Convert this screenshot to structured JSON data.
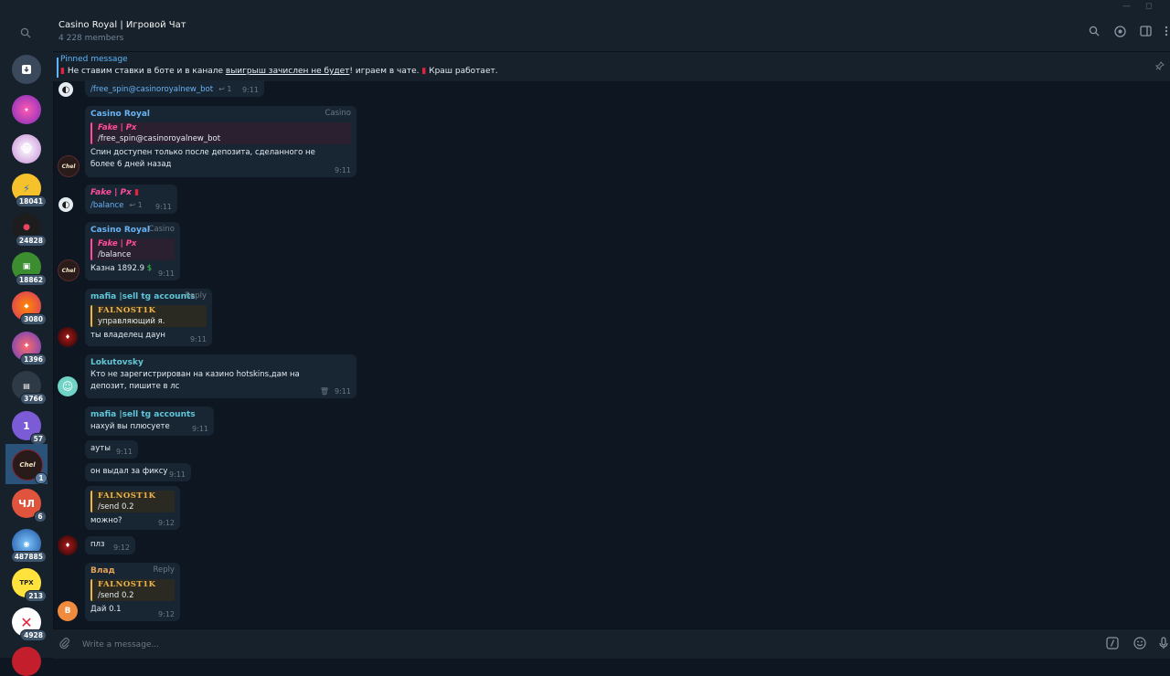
{
  "window": {
    "minimize": "—",
    "maximize": "◻"
  },
  "header": {
    "title": "Casino Royal | Игровой Чат",
    "members": "4 228 members"
  },
  "pinned": {
    "label": "Pinned message",
    "text_before": " Не ставим ставки в боте и в канале ",
    "text_underlined": "выигрыш зачислен не будет",
    "text_mid": "! играем в чате. ",
    "text_after": " Краш работает."
  },
  "rail": {
    "badges": [
      "18041",
      "24828",
      "18862",
      "3080",
      "1396",
      "3766",
      "57",
      "1",
      "6",
      "487885",
      "213",
      "4928"
    ],
    "chl_label": "ЧЛ",
    "one_label": "1"
  },
  "messages": {
    "m0": {
      "text": "/free_spin@casinoroyalnew_bot",
      "replies": "1",
      "time": "9:11"
    },
    "m1": {
      "sender": "Casino Royal",
      "tag": "Casino",
      "reply_name": "Fake | Px",
      "reply_text": "/free_spin@casinoroyalnew_bot",
      "text": "Спин доступен только после депозита, сделанного не более 6 дней назад",
      "time": "9:11"
    },
    "m2": {
      "sender": "Fake | Px",
      "text": "/balance",
      "replies": "1",
      "time": "9:11"
    },
    "m3": {
      "sender": "Casino Royal",
      "tag": "Casino",
      "reply_name": "Fake | Px",
      "reply_text": "/balance",
      "text": "Казна 1892.9",
      "time": "9:11"
    },
    "m4": {
      "sender": "mafia |sell tg accounts",
      "tag": "Reply",
      "reply_name": "FALNOST1K",
      "reply_text": "управляющий я.",
      "text": "ты владелец даун",
      "time": "9:11"
    },
    "m5": {
      "sender": "Lokutovsky",
      "text": "Кто не зарегистрирован на казино hotskins,дам на депозит, пишите в лс",
      "time": "9:11"
    },
    "m6": {
      "sender": "mafia |sell tg accounts",
      "text": "нахуй вы плюсуете",
      "time": "9:11"
    },
    "m7": {
      "text": "ауты",
      "time": "9:11"
    },
    "m8": {
      "text": "он выдал за фиксу",
      "time": "9:11"
    },
    "m9": {
      "reply_name": "FALNOST1K",
      "reply_text": "/send 0.2",
      "text": "можно?",
      "time": "9:12"
    },
    "m10": {
      "text": "плз",
      "time": "9:12"
    },
    "m11": {
      "sender": "Влад",
      "tag": "Reply",
      "reply_name": "FALNOST1K",
      "reply_text": "/send 0.2",
      "text": "Дай 0.1",
      "time": "9:12"
    }
  },
  "avatars": {
    "vlad": "В"
  },
  "composer": {
    "placeholder": "Write a message..."
  },
  "colors": {
    "bg": "#0e1621",
    "panel": "#17212b",
    "bubble": "#182533",
    "accent": "#5eb5f7",
    "casino_name": "#6ab3f3",
    "mafia_name": "#5fc7d9",
    "lokutovsky_name": "#63c7d6",
    "vlad_name": "#e8a35a",
    "bot_pink": "#ff4d9a",
    "falno_gold": "#f0b54a"
  }
}
